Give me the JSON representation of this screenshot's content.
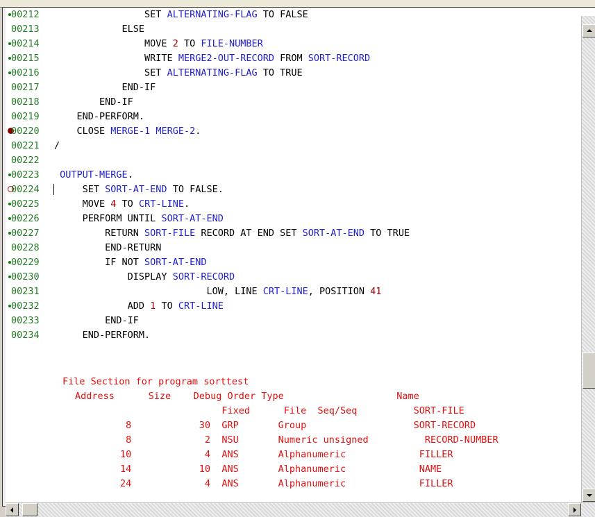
{
  "code_lines": [
    {
      "num": "00212",
      "mark": "dot",
      "tokens": [
        {
          "t": "                SET ",
          "c": "plain"
        },
        {
          "t": "ALTERNATING-FLAG",
          "c": "id"
        },
        {
          "t": " TO FALSE",
          "c": "plain"
        }
      ]
    },
    {
      "num": "00213",
      "mark": "",
      "tokens": [
        {
          "t": "            ELSE",
          "c": "plain"
        }
      ]
    },
    {
      "num": "00214",
      "mark": "dot",
      "tokens": [
        {
          "t": "                MOVE ",
          "c": "plain"
        },
        {
          "t": "2",
          "c": "num"
        },
        {
          "t": " TO ",
          "c": "plain"
        },
        {
          "t": "FILE-NUMBER",
          "c": "id"
        }
      ]
    },
    {
      "num": "00215",
      "mark": "dot",
      "tokens": [
        {
          "t": "                WRITE ",
          "c": "plain"
        },
        {
          "t": "MERGE2-OUT-RECORD",
          "c": "id"
        },
        {
          "t": " FROM ",
          "c": "plain"
        },
        {
          "t": "SORT-RECORD",
          "c": "id"
        }
      ]
    },
    {
      "num": "00216",
      "mark": "dot",
      "tokens": [
        {
          "t": "                SET ",
          "c": "plain"
        },
        {
          "t": "ALTERNATING-FLAG",
          "c": "id"
        },
        {
          "t": " TO TRUE",
          "c": "plain"
        }
      ]
    },
    {
      "num": "00217",
      "mark": "",
      "tokens": [
        {
          "t": "            END-IF",
          "c": "plain"
        }
      ]
    },
    {
      "num": "00218",
      "mark": "",
      "tokens": [
        {
          "t": "        END-IF",
          "c": "plain"
        }
      ]
    },
    {
      "num": "00219",
      "mark": "",
      "tokens": [
        {
          "t": "    END-PERFORM.",
          "c": "plain"
        }
      ]
    },
    {
      "num": "00220",
      "mark": "bp",
      "tokens": [
        {
          "t": "    CLOSE ",
          "c": "plain"
        },
        {
          "t": "MERGE-1",
          "c": "id"
        },
        {
          "t": " ",
          "c": "plain"
        },
        {
          "t": "MERGE-2",
          "c": "id"
        },
        {
          "t": ".",
          "c": "plain"
        }
      ]
    },
    {
      "num": "00221",
      "mark": "",
      "tokens": [
        {
          "t": "/",
          "c": "plain"
        }
      ]
    },
    {
      "num": "00222",
      "mark": "",
      "tokens": [
        {
          "t": "",
          "c": "plain"
        }
      ]
    },
    {
      "num": "00223",
      "mark": "dot",
      "tokens": [
        {
          "t": " ",
          "c": "plain"
        },
        {
          "t": "OUTPUT-MERGE",
          "c": "id"
        },
        {
          "t": ".",
          "c": "plain"
        }
      ]
    },
    {
      "num": "00224",
      "mark": "bpo",
      "tokens": [
        {
          "t": "     SET ",
          "c": "plain"
        },
        {
          "t": "SORT-AT-END",
          "c": "id"
        },
        {
          "t": " TO FALSE.",
          "c": "plain"
        }
      ]
    },
    {
      "num": "00225",
      "mark": "dot",
      "tokens": [
        {
          "t": "     MOVE ",
          "c": "plain"
        },
        {
          "t": "4",
          "c": "num"
        },
        {
          "t": " TO ",
          "c": "plain"
        },
        {
          "t": "CRT-LINE",
          "c": "id"
        },
        {
          "t": ".",
          "c": "plain"
        }
      ]
    },
    {
      "num": "00226",
      "mark": "dot",
      "tokens": [
        {
          "t": "     PERFORM UNTIL ",
          "c": "plain"
        },
        {
          "t": "SORT-AT-END",
          "c": "id"
        }
      ]
    },
    {
      "num": "00227",
      "mark": "dot",
      "tokens": [
        {
          "t": "         RETURN ",
          "c": "plain"
        },
        {
          "t": "SORT-FILE",
          "c": "id"
        },
        {
          "t": " RECORD AT END SET ",
          "c": "plain"
        },
        {
          "t": "SORT-AT-END",
          "c": "id"
        },
        {
          "t": " TO TRUE",
          "c": "plain"
        }
      ]
    },
    {
      "num": "00228",
      "mark": "",
      "tokens": [
        {
          "t": "         END-RETURN",
          "c": "plain"
        }
      ]
    },
    {
      "num": "00229",
      "mark": "dot",
      "tokens": [
        {
          "t": "         IF NOT ",
          "c": "plain"
        },
        {
          "t": "SORT-AT-END",
          "c": "id"
        }
      ]
    },
    {
      "num": "00230",
      "mark": "dot",
      "tokens": [
        {
          "t": "             DISPLAY ",
          "c": "plain"
        },
        {
          "t": "SORT-RECORD",
          "c": "id"
        }
      ]
    },
    {
      "num": "00231",
      "mark": "",
      "tokens": [
        {
          "t": "                           LOW, LINE ",
          "c": "plain"
        },
        {
          "t": "CRT-LINE",
          "c": "id"
        },
        {
          "t": ", POSITION ",
          "c": "plain"
        },
        {
          "t": "41",
          "c": "num"
        }
      ]
    },
    {
      "num": "00232",
      "mark": "dot",
      "tokens": [
        {
          "t": "             ADD ",
          "c": "plain"
        },
        {
          "t": "1",
          "c": "num"
        },
        {
          "t": " TO ",
          "c": "plain"
        },
        {
          "t": "CRT-LINE",
          "c": "id"
        }
      ]
    },
    {
      "num": "00233",
      "mark": "",
      "tokens": [
        {
          "t": "         END-IF",
          "c": "plain"
        }
      ]
    },
    {
      "num": "00234",
      "mark": "",
      "tokens": [
        {
          "t": "     END-PERFORM.",
          "c": "plain"
        }
      ]
    }
  ],
  "file_section": {
    "title": "File Section for program sorttest",
    "header1": "Address      Size    Debug Order Type                    Name",
    "header2": "                          Fixed      File  Seq/Seq          SORT-FILE",
    "rows": [
      "         8            30  GRP       Group                   SORT-RECORD",
      "         8             2  NSU       Numeric unsigned          RECORD-NUMBER",
      "        10             4  ANS       Alphanumeric             FILLER",
      "        14            10  ANS       Alphanumeric             NAME",
      "        24             4  ANS       Alphanumeric             FILLER"
    ]
  },
  "colors": {
    "line_number": "#237c23",
    "identifier": "#2020cc",
    "numeric": "#a00000",
    "file_section": "#e01010",
    "breakpoint": "#8b0000"
  }
}
